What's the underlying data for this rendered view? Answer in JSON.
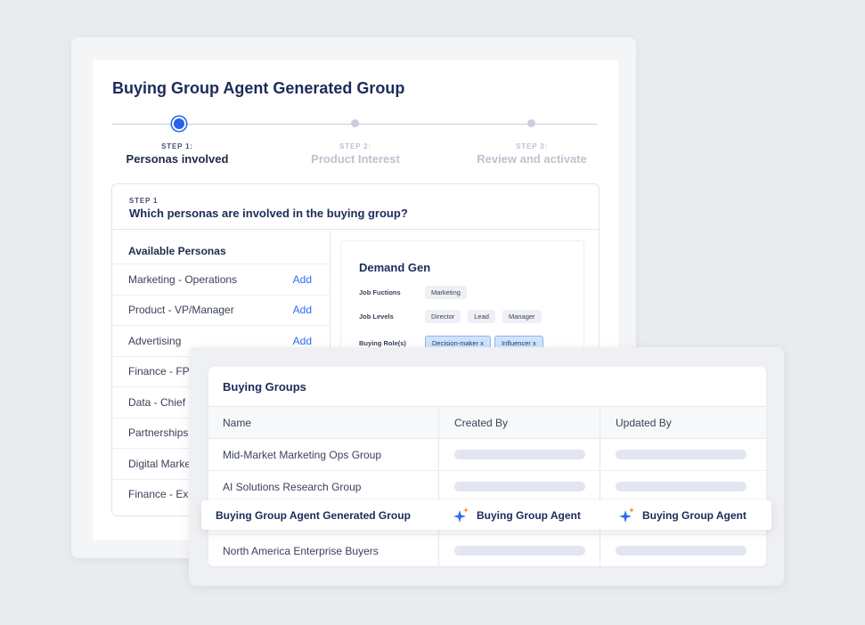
{
  "panel": {
    "title": "Buying Group Agent Generated Group",
    "steps": [
      {
        "small": "STEP 1:",
        "label": "Personas involved",
        "state": "active"
      },
      {
        "small": "STEP 2:",
        "label": "Product Interest",
        "state": "inactive"
      },
      {
        "small": "STEP 3:",
        "label": "Review and activate",
        "state": "inactive"
      }
    ],
    "question": {
      "step": "STEP 1",
      "text": "Which personas are involved in the buying group?"
    },
    "personas": {
      "heading": "Available Personas",
      "add_label": "Add",
      "items": [
        {
          "name": "Marketing - Operations",
          "add": "Add"
        },
        {
          "name": "Product - VP/Manager",
          "add": "Add"
        },
        {
          "name": "Advertising",
          "add": "Add"
        },
        {
          "name": "Finance - FP&A",
          "add": ""
        },
        {
          "name": "Data - Chief",
          "add": ""
        },
        {
          "name": "Partnerships",
          "add": ""
        },
        {
          "name": "Digital Marketing",
          "add": ""
        },
        {
          "name": "Finance - Exec",
          "add": ""
        }
      ]
    },
    "demand_gen": {
      "title": "Demand Gen",
      "job_functions_label": "Job Fuctions",
      "job_functions": [
        "Marketing"
      ],
      "job_levels_label": "Job Levels",
      "job_levels": [
        "Director",
        "Lead",
        "Manager"
      ],
      "buying_roles_label": "Buying Role(s)",
      "buying_roles": [
        "Decision-maker x",
        "Influencer x"
      ]
    }
  },
  "buying_groups": {
    "title": "Buying Groups",
    "columns": [
      "Name",
      "Created By",
      "Updated By"
    ],
    "rows": [
      {
        "name": "Mid-Market Marketing Ops Group"
      },
      {
        "name": "AI Solutions Research Group"
      }
    ],
    "highlight": {
      "name": "Buying Group Agent Generated Group",
      "created_by": "Buying Group Agent",
      "updated_by": "Buying Group Agent",
      "icon": "sparkle-icon"
    },
    "last_row": {
      "name": "North America Enterprise Buyers"
    }
  },
  "colors": {
    "accent": "#2563eb",
    "title": "#1c2b5a",
    "sparkle_blue": "#2b6cf0",
    "sparkle_orange": "#f08a24"
  }
}
